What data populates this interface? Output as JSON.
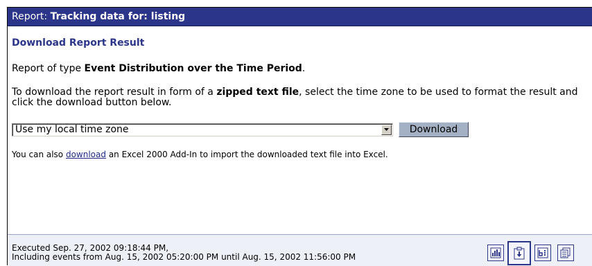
{
  "header": {
    "prefix": "Report: ",
    "title": "Tracking data for: listing"
  },
  "main": {
    "heading": "Download Report Result",
    "report_type_prefix": "Report of type ",
    "report_type": "Event Distribution over the Time Period",
    "report_type_suffix": ".",
    "instructions_prefix": "To download the report result in form of a ",
    "instructions_bold": "zipped text file",
    "instructions_suffix": ", select the time zone to be used to format the result and click the download button below.",
    "timezone_select": {
      "selected": "Use my local time zone"
    },
    "download_button": "Download",
    "addin_prefix": "You can also ",
    "addin_link": "download",
    "addin_suffix": " an Excel 2000 Add-In to import the downloaded text file into Excel."
  },
  "footer": {
    "executed": "Executed Sep. 27, 2002 09:18:44 PM,",
    "range": "Including events from Aug. 15, 2002 05:20:00 PM until Aug. 15, 2002 11:56:00 PM",
    "icons": [
      "bar-chart-icon",
      "download-report-icon",
      "report-settings-icon",
      "copy-report-icon"
    ]
  },
  "colors": {
    "title_bar": "#2b3589",
    "heading": "#2b3589",
    "button": "#a4b1c4",
    "footer_bg": "#eef0f8"
  }
}
